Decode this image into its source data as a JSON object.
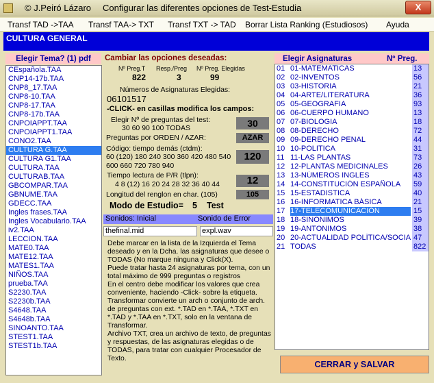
{
  "window": {
    "author": "© J.Peiró Lázaro",
    "title": "Configurar las diferentes opciones de Test-Estudia",
    "dots": "....",
    "close": "X"
  },
  "menu": [
    "Transf TAD ->TAA",
    "Transf TAA-> TXT",
    "Transf TXT -> TAD",
    "Borrar Lista Ranking (Estudiosos)",
    "Ayuda"
  ],
  "header": "CULTURA GENERAL",
  "left": {
    "label": "Elegir  Tema?   (1) pdf",
    "items": [
      "CEspañola.TAA",
      "CNP14-17b.TAA",
      "CNP8_17.TAA",
      "CNP8-10.TAA",
      "CNP8-17.TAA",
      "CNP8-17b.TAA",
      "CNPOIAPPT.TAA",
      "CNPOIAPPT1.TAA",
      "CONO2.TAA",
      "CULTURA G.TAA",
      "CULTURA G1.TAA",
      "CULTURA.TAA",
      "CULTURAB.TAA",
      "GBCOMPAR.TAA",
      "GBNUME.TAA",
      "GDECC.TAA",
      "Ingles frases.TAA",
      "Ingles Vocabulario.TAA",
      "iv2.TAA",
      "LECCION.TAA",
      "MATE0.TAA",
      "MATE12.TAA",
      "MATES1.TAA",
      "NIÑOS.TAA",
      "prueba.TAA",
      "S2230.TAA",
      "S2230b.TAA",
      "S4648.TAA",
      "S4648b.TAA",
      "SINOANTO.TAA",
      "STEST1.TAA",
      "STEST1b.TAA"
    ],
    "selected_index": 9
  },
  "center": {
    "heading": "Cambiar las opciones deseadas:",
    "col1": "Nº Preg.T",
    "col2": "Resp./Preg",
    "col3": "Nº Preg. Elegidas",
    "v1": "822",
    "v2": "3",
    "v3": "99",
    "num_label": "Números de Asignaturas Elegidas:",
    "num_value": "06101517",
    "click_hint": "-CLICK- en  casillas  modifica los campos:",
    "opt1_l1": "Elegir Nº de preguntas del test:",
    "opt1_l2": "30  60  90  100  TODAS",
    "opt1_val": "30",
    "opt2_l1": "Preguntas  por   ORDEN / AZAR:",
    "opt2_val": "AZAR",
    "opt3_l1": "Código:  tiempo demás     (ctdm):",
    "opt3_l2": "60 (120) 180 240 300 360 420 480 540",
    "opt3_l3": "600 660 720 780 940",
    "opt3_val": "120",
    "opt4_l1": "Tiempo lectura de P/R       (tlpn):",
    "opt4_l2": "4  8 (12) 16 20 24 28 32 36 40 44",
    "opt4_val": "12",
    "opt5_l1": "Longitud del renglon en char. (105)",
    "opt5_val": "105",
    "mode_label": "Modo de Estudio=",
    "mode_value": "5",
    "mode_unit": "Test",
    "sound_start": "Sonidos:  Inicial",
    "sound_err": "Sonido de  Error",
    "sound_start_file": "thefinal.mid",
    "sound_err_file": "expl.wav",
    "info": "Debe marcar en la lista de la Izquierda el Tema deseado y en la Dcha. las asignaturas que desee o TODAS (No marque ninguna y Click(X).\nPuede tratar hasta 24 asignaturas por tema, con un total máximo de 999 preguntas o registros\nEn el centro debe modificar los valores que crea conveniente, haciendo -Click- sobre la etiqueta.\nTransformar convierte un arch o conjunto de arch. de preguntas con ext. *.TAD en *.TAA, *.TXT en *.TAD y *.TAA en *.TXT, solo en la ventana de Transformar.\nArchivo TXT, crea un archivo de texto, de preguntas y respuestas, de las asignaturas elegidas o de TODAS, para tratar con cualquier Procesador de Texto."
  },
  "right": {
    "label": "Elegir Asignaturas",
    "count_label": "Nº Preg.",
    "rows": [
      {
        "num": "01",
        "name": "01-MATEMATICAS",
        "count": "13"
      },
      {
        "num": "02",
        "name": "02-INVENTOS",
        "count": "56"
      },
      {
        "num": "03",
        "name": "03-HISTORIA",
        "count": "21"
      },
      {
        "num": "04",
        "name": "04-ARTE/LITERATURA",
        "count": "36"
      },
      {
        "num": "05",
        "name": "05-GEOGRAFIA",
        "count": "93"
      },
      {
        "num": "06",
        "name": "06-CUERPO HUMANO",
        "count": "13"
      },
      {
        "num": "07",
        "name": "07-BIOLOGIA",
        "count": "18"
      },
      {
        "num": "08",
        "name": "08-DERECHO",
        "count": "72"
      },
      {
        "num": "09",
        "name": "09-DERECHO PENAL",
        "count": "44"
      },
      {
        "num": "10",
        "name": "10-POLITICA",
        "count": "31"
      },
      {
        "num": "11",
        "name": "11-LAS PLANTAS",
        "count": "73"
      },
      {
        "num": "12",
        "name": "12-PLANTAS MEDICINALES",
        "count": "26"
      },
      {
        "num": "13",
        "name": "13-NÚMEROS INGLES",
        "count": "43"
      },
      {
        "num": "14",
        "name": "14-CONSTITUCIÓN ESPAÑOLA",
        "count": "59"
      },
      {
        "num": "15",
        "name": "15-ESTADISTICA",
        "count": "40"
      },
      {
        "num": "16",
        "name": "16-INFORMATICA BÁSICA",
        "count": "21"
      },
      {
        "num": "17",
        "name": "17-TELECOMUNICACIÓN",
        "count": "15"
      },
      {
        "num": "18",
        "name": "18-SINONIMOS",
        "count": "39"
      },
      {
        "num": "19",
        "name": "19-ANTONIMOS",
        "count": "38"
      },
      {
        "num": "20",
        "name": "20-ACTUALIDAD POLÍTICA/SOCIAL",
        "count": "47"
      },
      {
        "num": "21",
        "name": "TODAS",
        "count": "822"
      }
    ],
    "selected_index": 16
  },
  "save_button": "CERRAR y SALVAR"
}
